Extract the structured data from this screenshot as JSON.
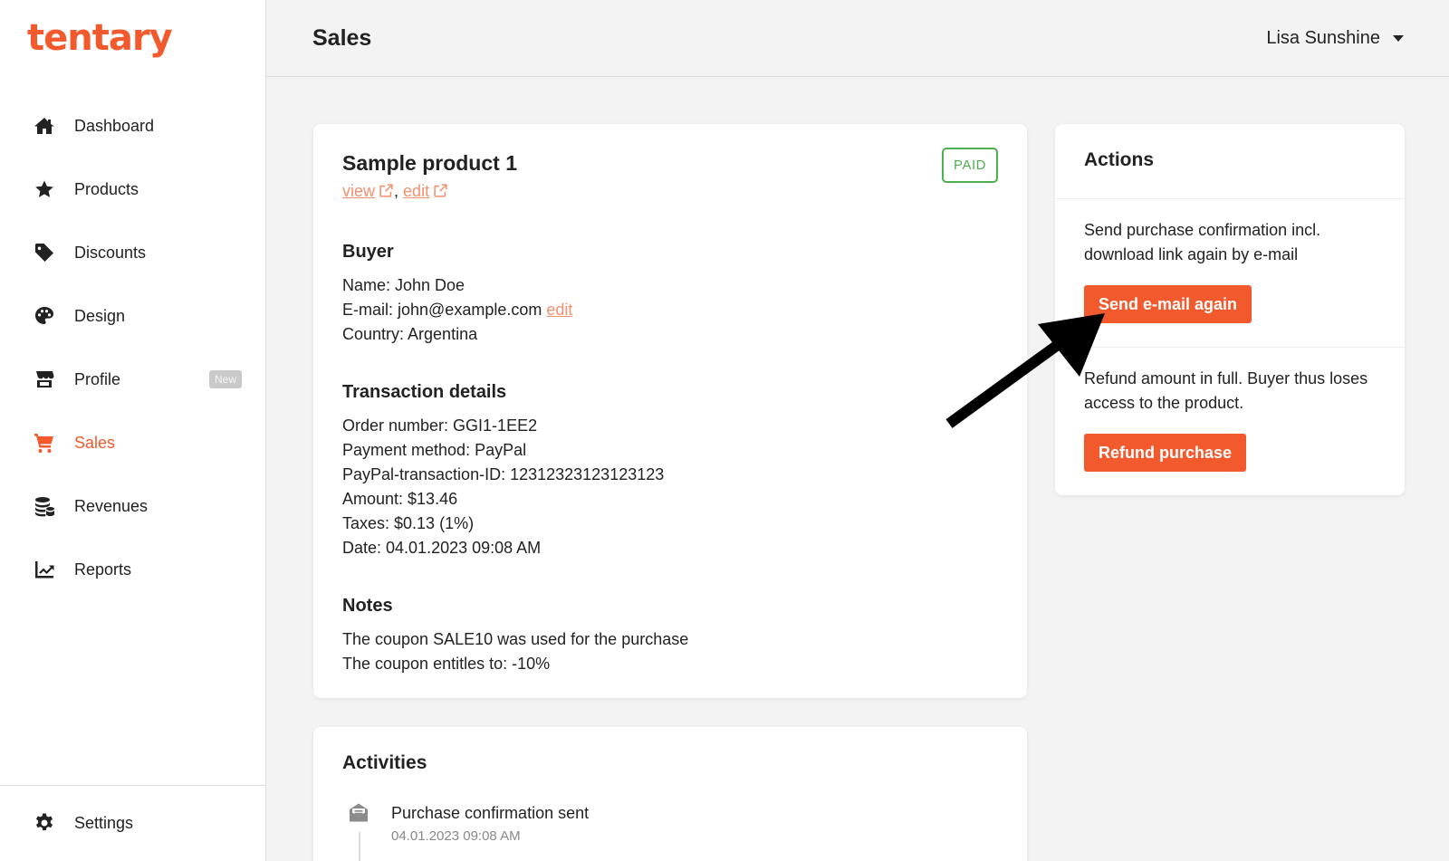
{
  "brand": {
    "logo_text": "tentary",
    "accent_color": "#f2592d"
  },
  "sidebar": {
    "items": [
      {
        "label": "Dashboard",
        "icon": "home-icon"
      },
      {
        "label": "Products",
        "icon": "star-icon"
      },
      {
        "label": "Discounts",
        "icon": "tag-icon"
      },
      {
        "label": "Design",
        "icon": "palette-icon"
      },
      {
        "label": "Profile",
        "icon": "store-icon",
        "badge": "New"
      },
      {
        "label": "Sales",
        "icon": "cart-icon",
        "active": true
      },
      {
        "label": "Revenues",
        "icon": "coins-icon"
      },
      {
        "label": "Reports",
        "icon": "chart-line-icon"
      }
    ],
    "settings": {
      "label": "Settings",
      "icon": "gear-icon"
    }
  },
  "header": {
    "title": "Sales",
    "user_name": "Lisa Sunshine"
  },
  "sale": {
    "product_title": "Sample product 1",
    "view_label": "view",
    "edit_label": "edit",
    "separator": ",",
    "status": "PAID",
    "status_color": "#4caf50",
    "buyer": {
      "heading": "Buyer",
      "name": "Name: John Doe",
      "email": "E-mail: john@example.com",
      "email_edit": "edit",
      "country": "Country: Argentina"
    },
    "transaction": {
      "heading": "Transaction details",
      "order_number": "Order number: GGI1-1EE2",
      "payment_method": "Payment method: PayPal",
      "paypal_id": "PayPal-transaction-ID: 12312323123123123",
      "amount": "Amount: $13.46",
      "taxes": "Taxes: $0.13 (1%)",
      "date": "Date: 04.01.2023 09:08 AM"
    },
    "notes": {
      "heading": "Notes",
      "line1": "The coupon SALE10 was used for the purchase",
      "line2": "The coupon entitles to: -10%"
    }
  },
  "actions": {
    "title": "Actions",
    "resend_text": "Send purchase confirmation incl. download link again by e-mail",
    "resend_button": "Send e-mail again",
    "refund_text": "Refund amount in full. Buyer thus loses access to the product.",
    "refund_button": "Refund purchase"
  },
  "activities": {
    "title": "Activities",
    "items": [
      {
        "icon": "envelope-open-icon",
        "title": "Purchase confirmation sent",
        "time": "04.01.2023 09:08 AM"
      }
    ]
  }
}
